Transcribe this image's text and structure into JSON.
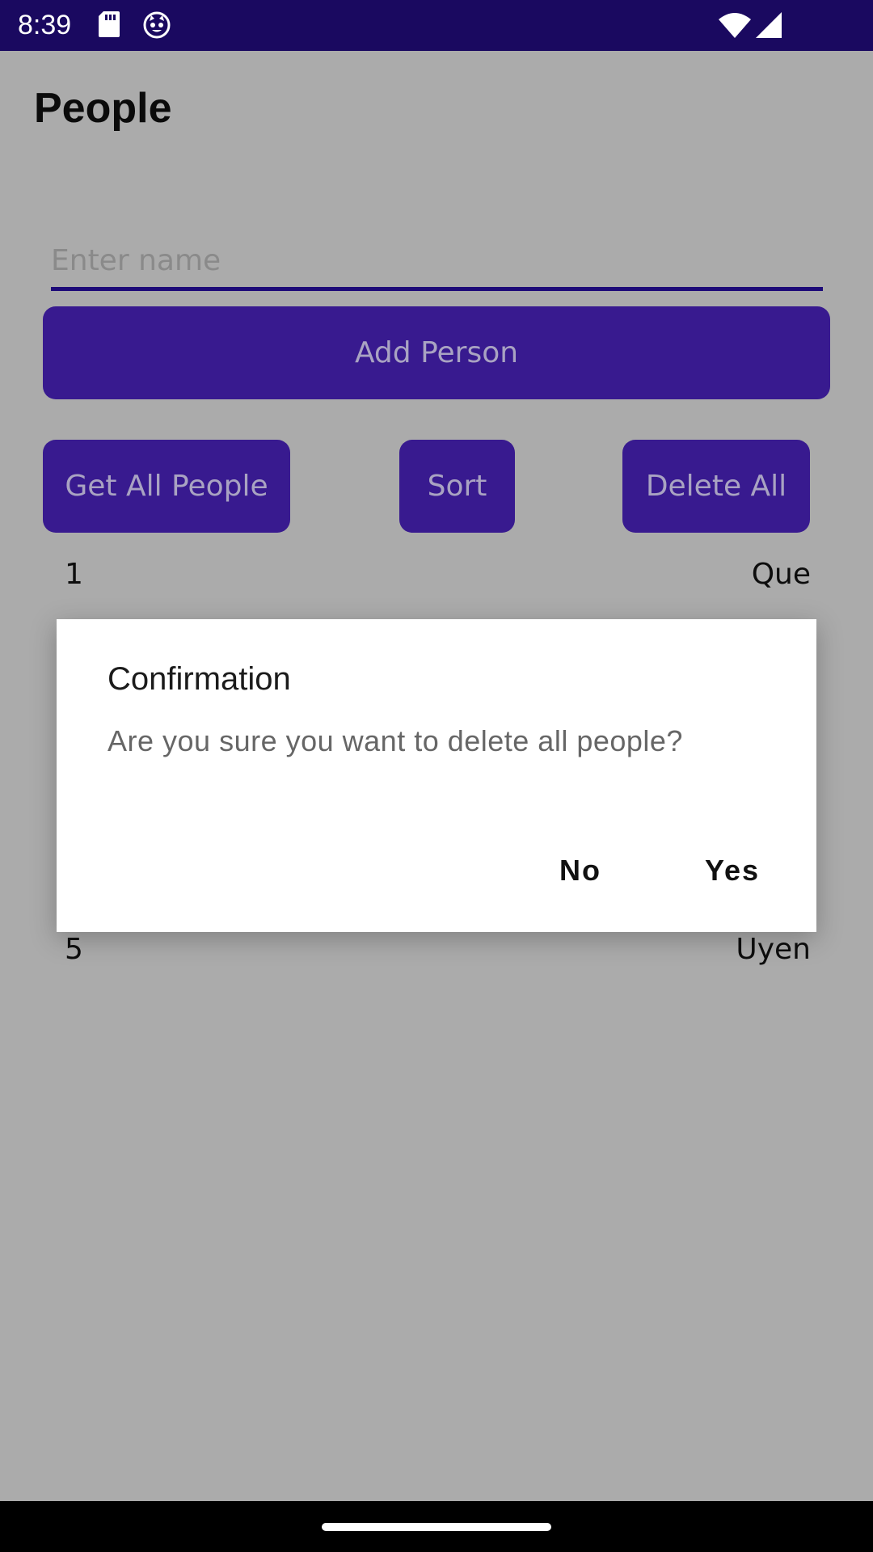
{
  "status_bar": {
    "time": "8:39",
    "icons": [
      "sd-card-icon",
      "cat-face-icon",
      "wifi-icon",
      "signal-icon"
    ]
  },
  "page": {
    "title": "People"
  },
  "form": {
    "name_placeholder": "Enter name",
    "add_button": "Add Person"
  },
  "actions": {
    "get_all": "Get All People",
    "sort": "Sort",
    "delete_all": "Delete All"
  },
  "people": [
    {
      "id": "1",
      "name": "Que"
    },
    {
      "id": "5",
      "name": "Uyen"
    }
  ],
  "dialog": {
    "title": "Confirmation",
    "message": "Are you sure you want to delete all people?",
    "no": "No",
    "yes": "Yes"
  },
  "colors": {
    "status_bar": "#1a0960",
    "button": "#381a8f",
    "scrim": "#ababab",
    "input_underline": "#1d0a78"
  }
}
